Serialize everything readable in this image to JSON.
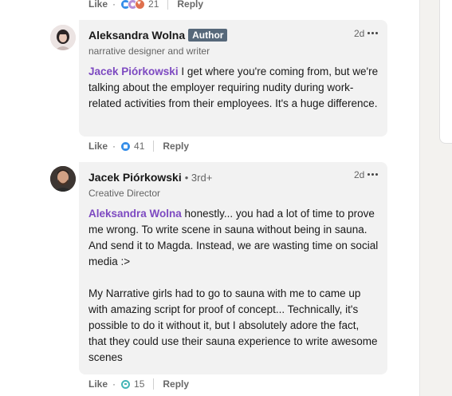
{
  "reaction_colors": {
    "like": "#378fe9",
    "support": "#b68fd7",
    "love": "#df704d",
    "funny": "#44b5b6"
  },
  "top_actions": {
    "like": "Like",
    "dot": "·",
    "reactions": [
      "like",
      "support",
      "love"
    ],
    "count": "21",
    "reply": "Reply"
  },
  "comments": [
    {
      "author": "Aleksandra Wolna",
      "badge": "Author",
      "degree": "",
      "headline": "narrative designer and writer",
      "time": "2d",
      "mention": "Jacek Piórkowski",
      "text": " I get where you're coming from, but we're talking about the employer requiring nudity during work-related activities from their employees. It's a huge difference.",
      "actions": {
        "like": "Like",
        "dot": "·",
        "reaction": "like",
        "count": "41",
        "reply": "Reply"
      }
    },
    {
      "author": "Jacek Piórkowski",
      "badge": "",
      "degree": "• 3rd+",
      "headline": "Creative Director",
      "time": "2d",
      "mention": "Aleksandra Wolna",
      "text": " honestly... you had a lot of time to prove me wrong. To write scene in sauna without being in sauna. And send it to Magda. Instead, we are wasting time on social media :>",
      "text2": "My Narrative girls had to go to sauna with me to came up with amazing script for proof of concept... Technically, it's possible to do it without it, but I absolutely adore the fact, that they could use their sauna experience to write awesome scenes",
      "actions": {
        "like": "Like",
        "dot": "·",
        "reaction": "funny",
        "count": "15",
        "reply": "Reply"
      }
    }
  ]
}
